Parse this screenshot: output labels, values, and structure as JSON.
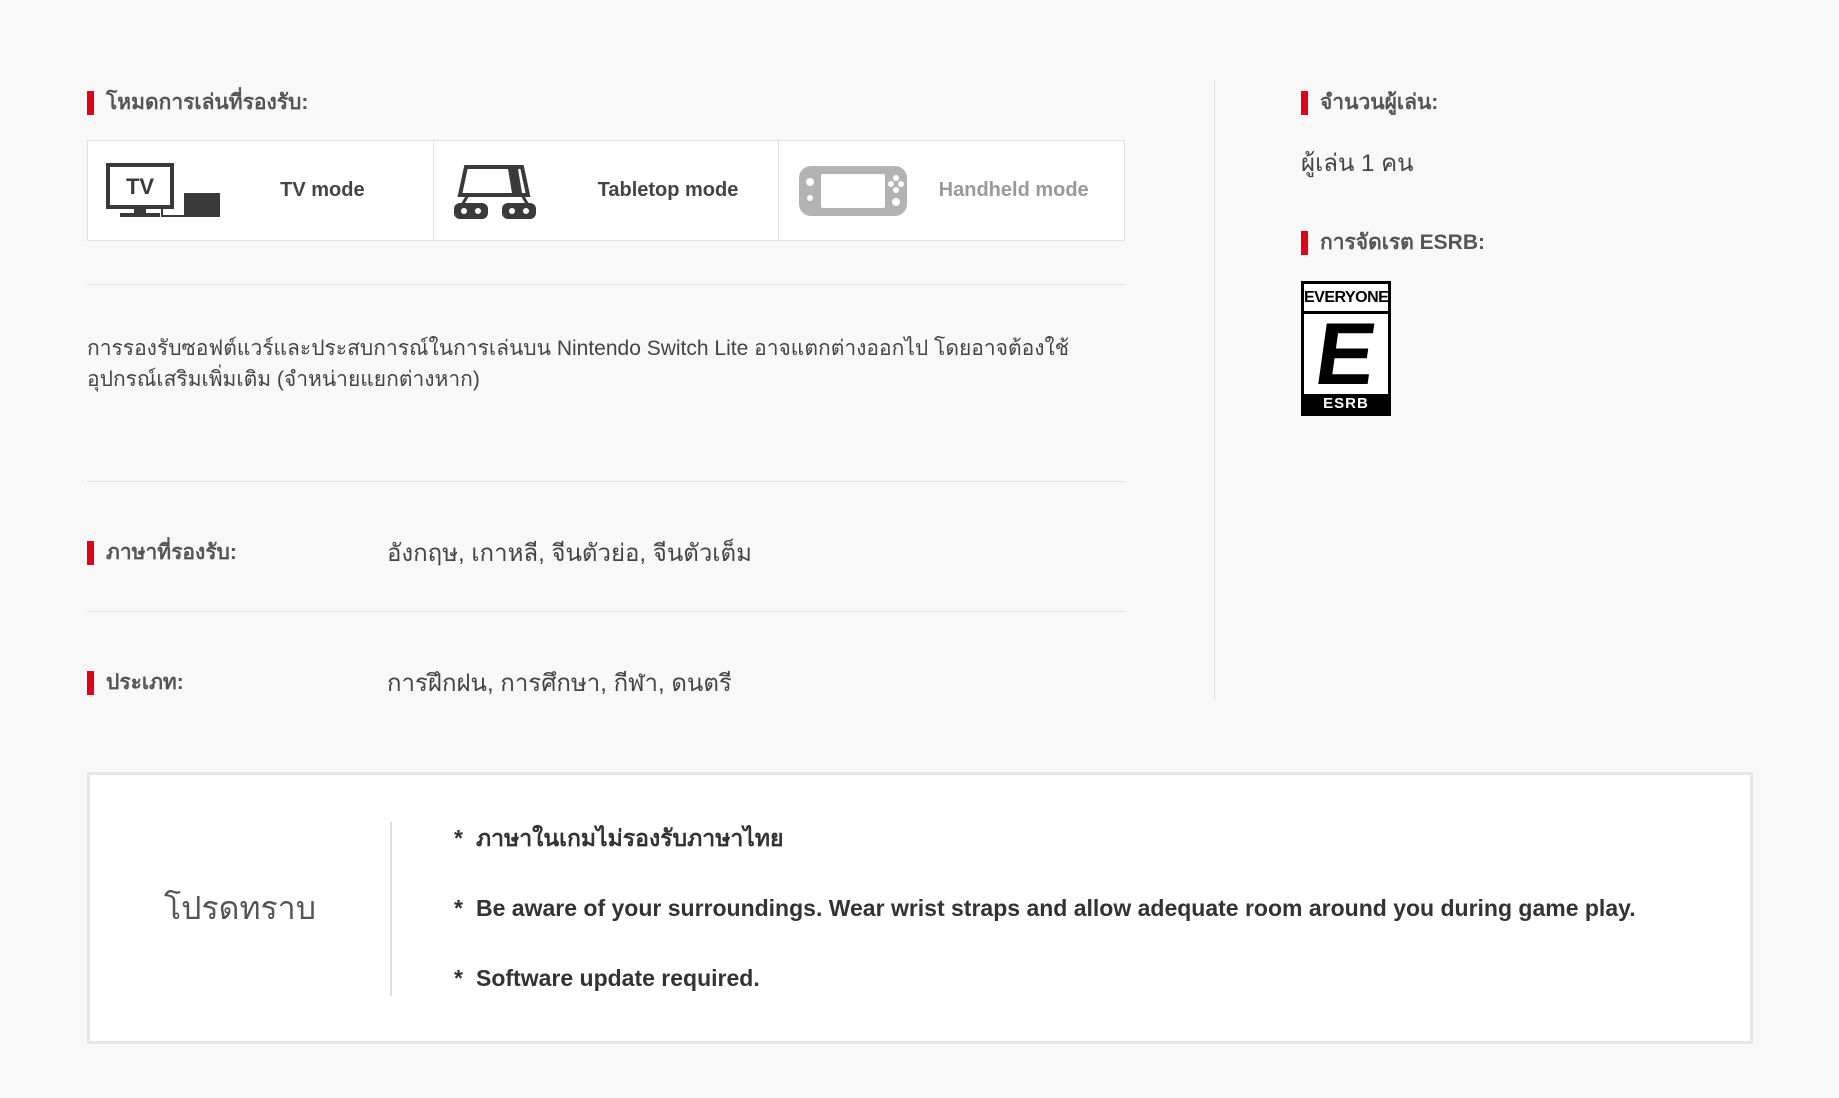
{
  "play_modes": {
    "heading": "โหมดการเล่นที่รองรับ:",
    "items": [
      {
        "label": "TV mode",
        "icon": "tv-mode-icon"
      },
      {
        "label": "Tabletop mode",
        "icon": "tabletop-mode-icon"
      },
      {
        "label": "Handheld mode",
        "icon": "handheld-mode-icon"
      }
    ],
    "tv_icon_text": "TV"
  },
  "compatibility_note": "การรองรับซอฟต์แวร์และประสบการณ์ในการเล่นบน Nintendo Switch Lite อาจแตกต่างออกไป โดยอาจต้องใช้อุปกรณ์เสริมเพิ่มเติม (จำหน่ายแยกต่างหาก)",
  "languages": {
    "label": "ภาษาที่รองรับ:",
    "value": "อังกฤษ, เกาหลี, จีนตัวย่อ, จีนตัวเต็ม"
  },
  "genre": {
    "label": "ประเภท:",
    "value": "การฝึกฝน, การศึกษา, กีฬา, ดนตรี"
  },
  "players": {
    "label": "จำนวนผู้เล่น:",
    "value": "ผู้เล่น 1 คน"
  },
  "esrb": {
    "label": "การจัดเรต ESRB:",
    "top_text": "EVERYONE",
    "letter": "E",
    "bottom_text": "ESRB"
  },
  "notice": {
    "title": "โปรดทราบ",
    "bullet": "*",
    "items": [
      "ภาษาในเกมไม่รองรับภาษาไทย",
      "Be aware of your surroundings. Wear wrist straps and allow adequate room around you during game play.",
      "Software update required."
    ]
  },
  "colors": {
    "accent": "#e60012",
    "background": "#f8f8f8"
  }
}
